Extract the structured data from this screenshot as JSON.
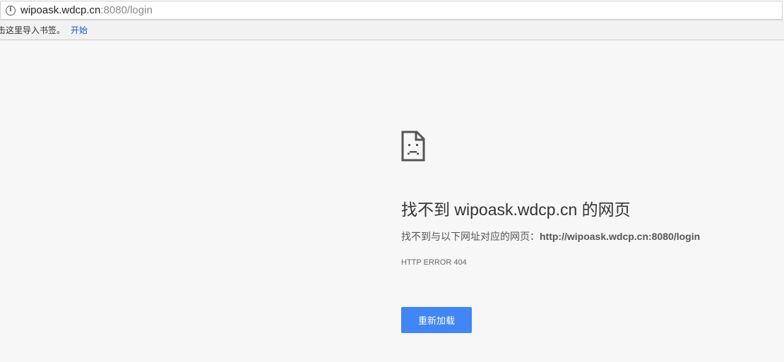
{
  "address_bar": {
    "host": "wipoask.wdcp.cn",
    "rest": ":8080/login"
  },
  "bookmarks_bar": {
    "hint": "击这里导入书签。",
    "link": "开始"
  },
  "error_page": {
    "icon": "sad-document-icon",
    "title": "找不到 wipoask.wdcp.cn 的网页",
    "description_prefix": "找不到与以下网址对应的网页：",
    "description_url": "http://wipoask.wdcp.cn:8080/login",
    "error_code": "HTTP ERROR 404",
    "reload_label": "重新加载"
  },
  "colors": {
    "background": "#f7f7f7",
    "button": "#4285f4",
    "link": "#1a56c8"
  }
}
